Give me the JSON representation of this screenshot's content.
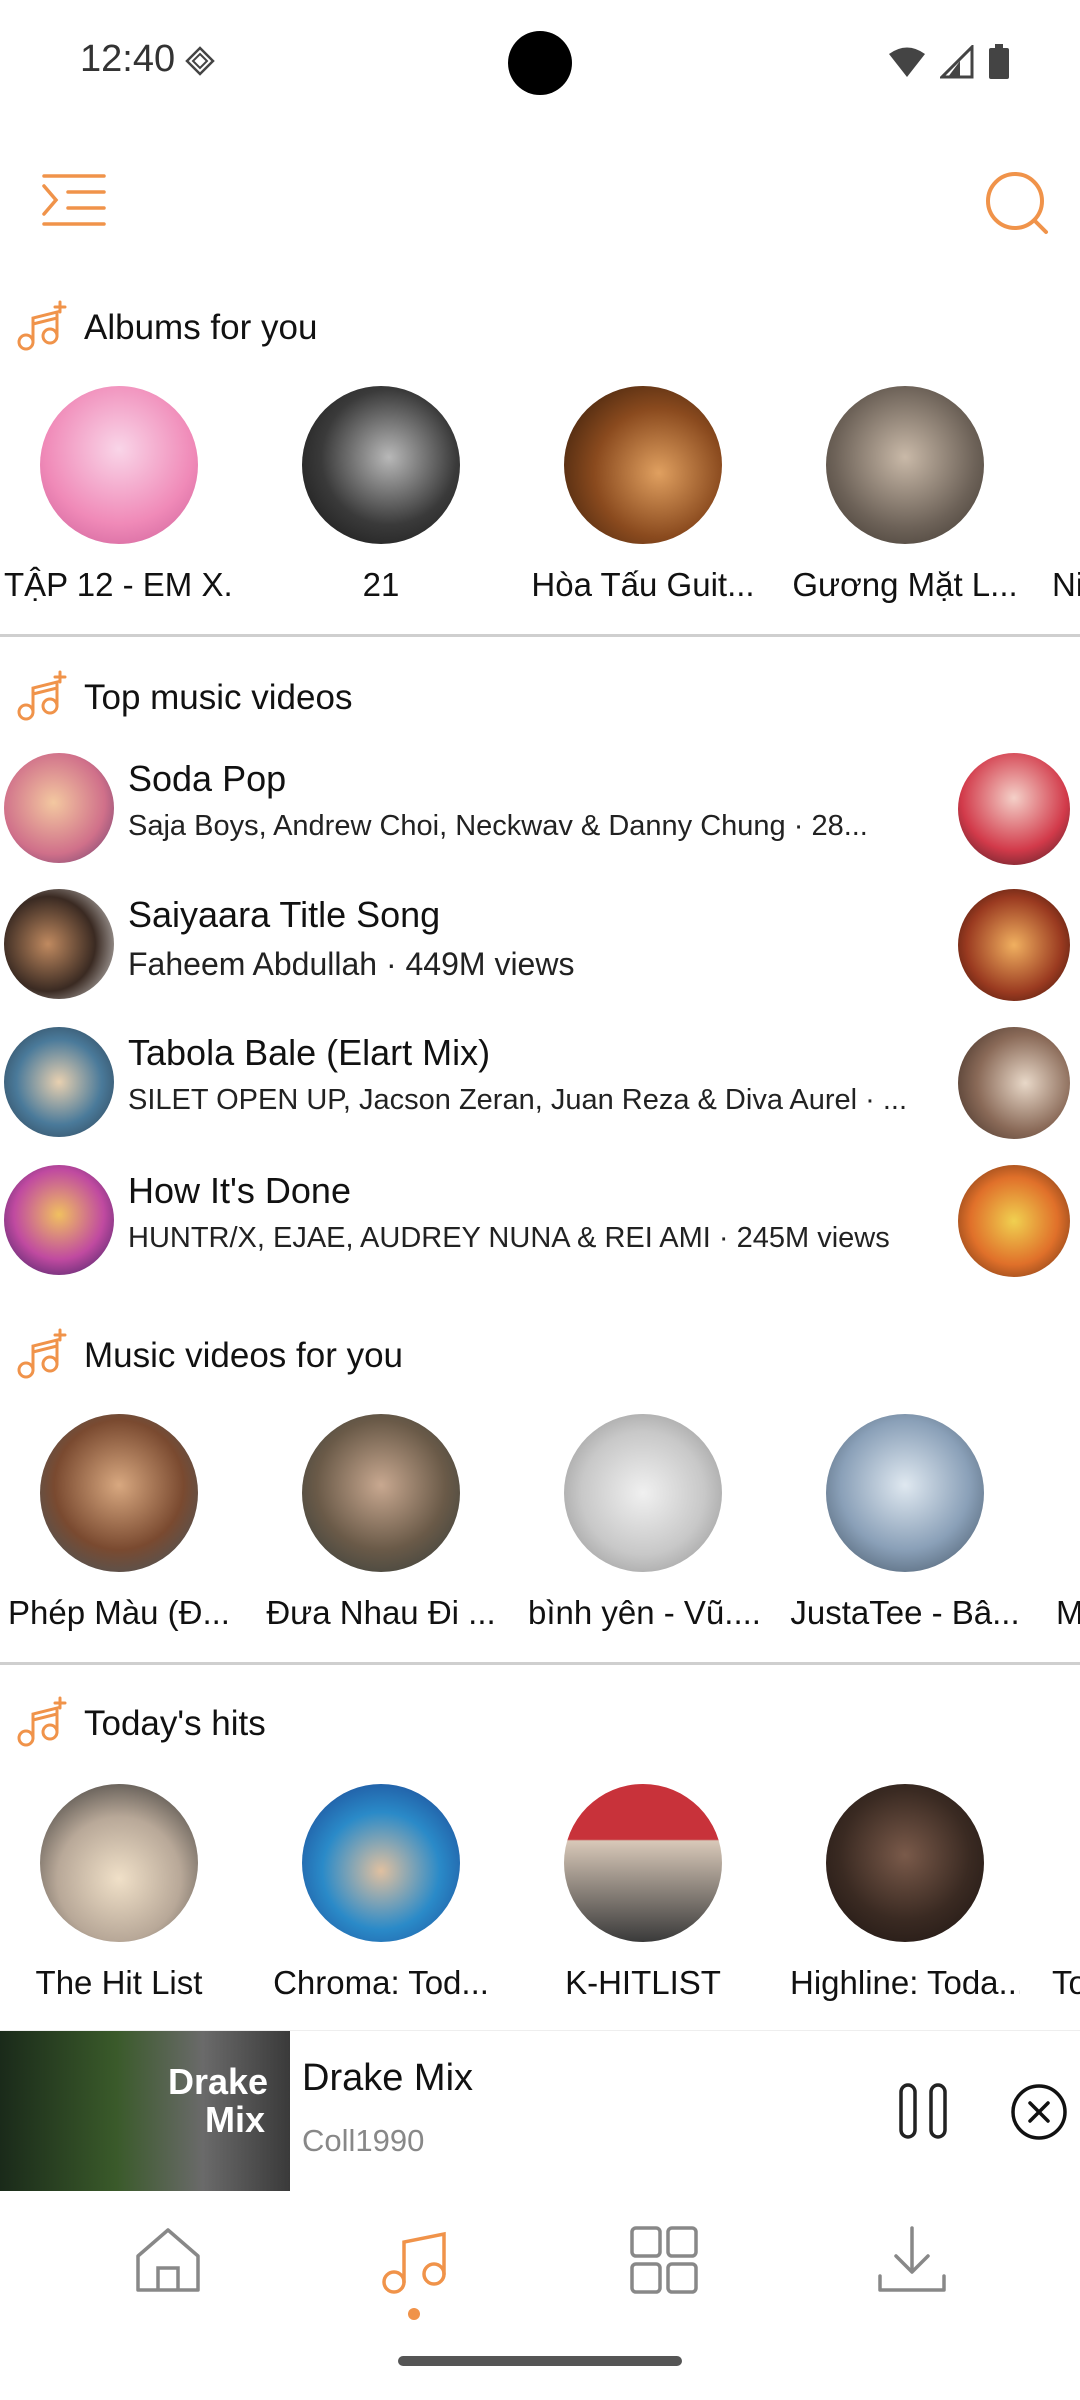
{
  "status_bar": {
    "time": "12:40"
  },
  "colors": {
    "accent": "#f0934a"
  },
  "icons": {
    "menu": "menu-indent-icon",
    "search": "search-icon",
    "section": "music-note-sparkle-icon",
    "nav": [
      "home-icon",
      "music-note-icon",
      "grid-icon",
      "download-icon"
    ]
  },
  "albums_for_you": {
    "title": "Albums for you",
    "items": [
      "TẬP 12 - EM X...",
      "21",
      "Hòa Tấu Guit...",
      "Gương Mặt L...",
      "Ni"
    ]
  },
  "top_music_videos": {
    "title": "Top music videos",
    "items": [
      {
        "title": "Soda Pop",
        "subtitle": "Saja Boys, Andrew Choi, Neckwav & Danny Chung · 28..."
      },
      {
        "title": "Saiyaara Title Song",
        "subtitle": "Faheem Abdullah · 449M views"
      },
      {
        "title": "Tabola Bale (Elart Mix)",
        "subtitle": "SILET OPEN UP, Jacson Zeran, Juan Reza & Diva Aurel · ..."
      },
      {
        "title": "How It's Done",
        "subtitle": "HUNTR/X, EJAE, AUDREY NUNA & REI AMI · 245M views"
      }
    ]
  },
  "music_videos_for_you": {
    "title": "Music videos for you",
    "items": [
      "Phép Màu (Đ...",
      "Đưa Nhau Đi ...",
      "bình yên - Vũ....",
      "JustaTee - Bâ...",
      "M"
    ]
  },
  "todays_hits": {
    "title": "Today's hits",
    "items": [
      "The Hit List",
      "Chroma: Tod...",
      "K-HITLIST",
      "Highline: Toda...",
      "To"
    ]
  },
  "player": {
    "title": "Drake Mix",
    "artist": "Coll1990",
    "art_text_1": "Drake",
    "art_text_2": "Mix"
  }
}
